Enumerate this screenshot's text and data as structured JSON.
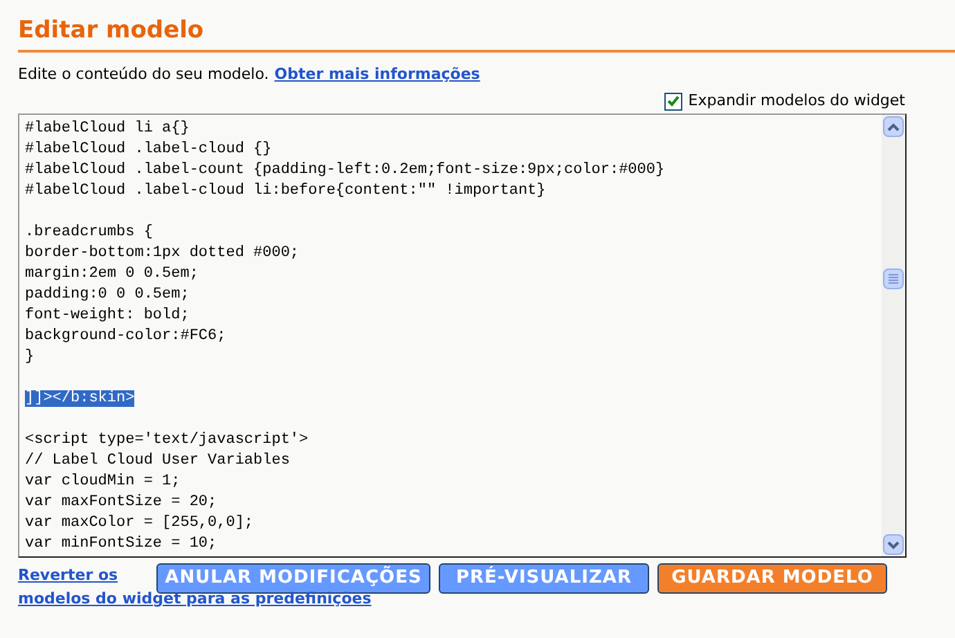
{
  "title": "Editar modelo",
  "intro": {
    "text": "Edite o conteúdo do seu modelo.",
    "link": "Obter mais informações"
  },
  "expand_checkbox": {
    "label": "Expandir modelos do widget",
    "checked": true
  },
  "editor": {
    "blocks": [
      {
        "lines": [
          {
            "text": "#labelCloud li a{}",
            "selected": false
          },
          {
            "text": "#labelCloud .label-cloud {}",
            "selected": false
          },
          {
            "text": "#labelCloud .label-count {padding-left:0.2em;font-size:9px;color:#000}",
            "selected": false
          },
          {
            "text": "#labelCloud .label-cloud li:before{content:\"\" !important}",
            "selected": false
          }
        ]
      },
      {
        "lines": [
          {
            "text": ".breadcrumbs {",
            "selected": false
          },
          {
            "text": "border-bottom:1px dotted #000;",
            "selected": false
          },
          {
            "text": "margin:2em 0 0.5em;",
            "selected": false
          },
          {
            "text": "padding:0 0 0.5em;",
            "selected": false
          },
          {
            "text": "font-weight: bold;",
            "selected": false
          },
          {
            "text": "background-color:#FC6;",
            "selected": false
          },
          {
            "text": "}",
            "selected": false
          }
        ]
      },
      {
        "lines": [
          {
            "text": "]]></b:skin>",
            "selected": true
          }
        ]
      },
      {
        "lines": [
          {
            "text": "<script type='text/javascript'>",
            "selected": false
          },
          {
            "text": "// Label Cloud User Variables",
            "selected": false
          },
          {
            "text": "var cloudMin = 1;",
            "selected": false
          },
          {
            "text": "var maxFontSize = 20;",
            "selected": false
          },
          {
            "text": "var maxColor = [255,0,0];",
            "selected": false
          },
          {
            "text": "var minFontSize = 10;",
            "selected": false
          }
        ]
      }
    ]
  },
  "revert_link": {
    "line_1": "Reverter os",
    "line_2": "modelos do widget para as predefinições"
  },
  "buttons": [
    {
      "label": "ANULAR MODIFICAÇÕES",
      "kind": "secondary"
    },
    {
      "label": "PRÉ-VISUALIZAR",
      "kind": "secondary"
    },
    {
      "label": "GUARDAR MODELO",
      "kind": "primary"
    }
  ]
}
